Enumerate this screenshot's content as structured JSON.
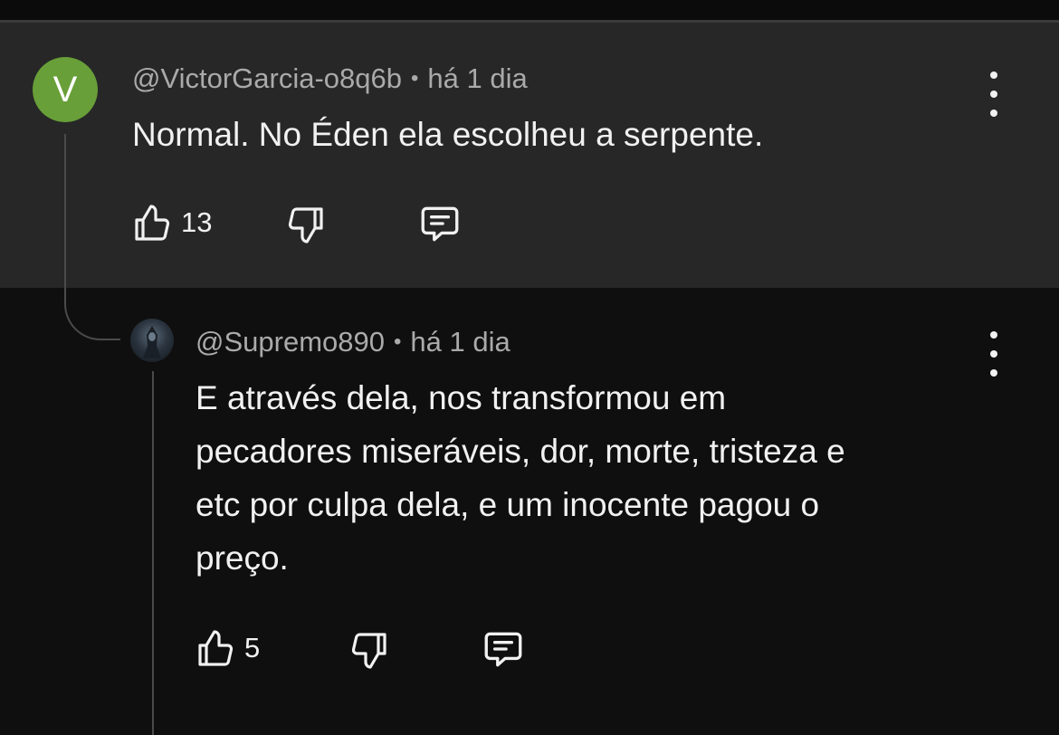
{
  "comment": {
    "avatar_letter": "V",
    "author": "@VictorGarcia-o8q6b",
    "separator": "•",
    "time": "há 1 dia",
    "text": "Normal. No Éden ela escolheu a serpente.",
    "likes": "13"
  },
  "reply": {
    "author": "@Supremo890",
    "separator": "•",
    "time": "há 1 dia",
    "text_lines": [
      "E através dela, nos transformou em",
      "pecadores miseráveis, dor, morte, tristeza e",
      "etc por culpa dela, e um inocente pagou o",
      "preço."
    ],
    "likes": "5"
  },
  "colors": {
    "avatar_bg": "#689f38",
    "panel_bg": "#272727",
    "page_bg": "#0f0f0f",
    "meta_text": "#aaaaaa"
  },
  "icons": [
    "like-icon",
    "dislike-icon",
    "reply-icon",
    "more-vert-icon"
  ]
}
